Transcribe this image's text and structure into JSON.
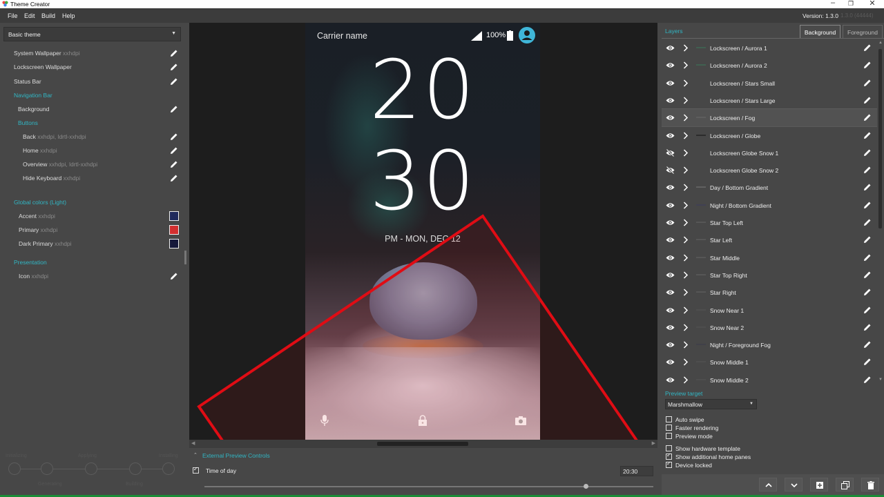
{
  "window": {
    "title": "Theme Creator"
  },
  "menu": {
    "items": [
      "File",
      "Edit",
      "Build",
      "Help"
    ],
    "version": "Version: 1.3.0",
    "build": "1.3.0 (44444)"
  },
  "left": {
    "theme_select": "Basic theme",
    "tree": [
      {
        "label": "System Wallpaper",
        "sub": "xxhdpi",
        "indent": 0,
        "head": false,
        "edit": true
      },
      {
        "label": "Lockscreen Wallpaper",
        "sub": "",
        "indent": 0,
        "head": false,
        "edit": true
      },
      {
        "label": "Status Bar",
        "sub": "",
        "indent": 0,
        "head": false,
        "edit": true
      },
      {
        "label": "Navigation Bar",
        "sub": "",
        "indent": 0,
        "head": true,
        "edit": false
      },
      {
        "label": "Background",
        "sub": "",
        "indent": 1,
        "head": false,
        "edit": true
      },
      {
        "label": "Buttons",
        "sub": "",
        "indent": 1,
        "head": true,
        "edit": false
      },
      {
        "label": "Back",
        "sub": "xxhdpi, ldrtl-xxhdpi",
        "indent": 2,
        "head": false,
        "edit": true
      },
      {
        "label": "Home",
        "sub": "xxhdpi",
        "indent": 2,
        "head": false,
        "edit": true
      },
      {
        "label": "Overview",
        "sub": "xxhdpi, ldrtl-xxhdpi",
        "indent": 2,
        "head": false,
        "edit": true
      },
      {
        "label": "Hide Keyboard",
        "sub": "xxhdpi",
        "indent": 2,
        "head": false,
        "edit": true
      }
    ],
    "global_colors_label": "Global colors (Light)",
    "colors": [
      {
        "label": "Accent",
        "sub": "xxhdpi",
        "color": "#1f2a5c"
      },
      {
        "label": "Primary",
        "sub": "xxhdpi",
        "color": "#d32f2f"
      },
      {
        "label": "Dark Primary",
        "sub": "xxhdpi",
        "color": "#15183a"
      }
    ],
    "presentation_label": "Presentation",
    "icon_row": {
      "label": "Icon",
      "sub": "xxhdpi"
    },
    "steps": [
      "Initializing",
      "Generating",
      "Applying",
      "Building",
      "Installing"
    ]
  },
  "preview": {
    "carrier": "Carrier name",
    "battery": "100%",
    "clock_hours": "20",
    "clock_minutes": "30",
    "date": "PM - MON, DEC 12",
    "accent": "#3fb6d9",
    "annotation_color": "#e00c14"
  },
  "external_controls": {
    "header": "External Preview Controls",
    "time_of_day_label": "Time of day",
    "time_of_day_checked": true,
    "time_value": "20:30",
    "slider_value": 0.855
  },
  "right": {
    "layers_label": "Layers",
    "tabs": [
      "Background",
      "Foreground"
    ],
    "active_tab": "Background",
    "layers": [
      {
        "name": "Lockscreen / Aurora 1",
        "visible": true,
        "thumb": "#3a7a5a"
      },
      {
        "name": "Lockscreen / Aurora 2",
        "visible": true,
        "thumb": "#3a7a5a"
      },
      {
        "name": "Lockscreen / Stars Small",
        "visible": true,
        "thumb": ""
      },
      {
        "name": "Lockscreen / Stars Large",
        "visible": true,
        "thumb": ""
      },
      {
        "name": "Lockscreen / Fog",
        "visible": true,
        "thumb": "#6a6a6a",
        "selected": true
      },
      {
        "name": "Lockscreen / Globe",
        "visible": true,
        "thumb": "#111111"
      },
      {
        "name": "Lockscreen Globe Snow 1",
        "visible": false,
        "thumb": ""
      },
      {
        "name": "Lockscreen Globe Snow 2",
        "visible": false,
        "thumb": ""
      },
      {
        "name": "Day / Bottom Gradient",
        "visible": true,
        "thumb": "#7a7a7a"
      },
      {
        "name": "Night / Bottom Gradient",
        "visible": true,
        "thumb": "#3a3a60"
      },
      {
        "name": "Star Top Left",
        "visible": true,
        "thumb": "#666"
      },
      {
        "name": "Star Left",
        "visible": true,
        "thumb": "#666"
      },
      {
        "name": "Star Middle",
        "visible": true,
        "thumb": "#666"
      },
      {
        "name": "Star Top Right",
        "visible": true,
        "thumb": "#666"
      },
      {
        "name": "Star Right",
        "visible": true,
        "thumb": "#666"
      },
      {
        "name": "Snow Near 1",
        "visible": true,
        "thumb": "#555"
      },
      {
        "name": "Snow Near 2",
        "visible": true,
        "thumb": "#555"
      },
      {
        "name": "Night / Foreground Fog",
        "visible": true,
        "thumb": "#3a3a4a"
      },
      {
        "name": "Snow Middle 1",
        "visible": true,
        "thumb": "#555"
      },
      {
        "name": "Snow Middle 2",
        "visible": true,
        "thumb": "#555"
      }
    ],
    "preview_target_label": "Preview target",
    "preview_target_value": "Marshmallow",
    "options_a": [
      {
        "label": "Auto swipe",
        "checked": false
      },
      {
        "label": "Faster rendering",
        "checked": false
      },
      {
        "label": "Preview mode",
        "checked": false
      }
    ],
    "options_b": [
      {
        "label": "Show hardware template",
        "checked": false
      },
      {
        "label": "Show additional home panes",
        "checked": true
      },
      {
        "label": "Device locked",
        "checked": true
      }
    ],
    "bottom_buttons": [
      "move-up-icon",
      "move-down-icon",
      "add-layer-icon",
      "duplicate-icon",
      "delete-icon"
    ]
  }
}
